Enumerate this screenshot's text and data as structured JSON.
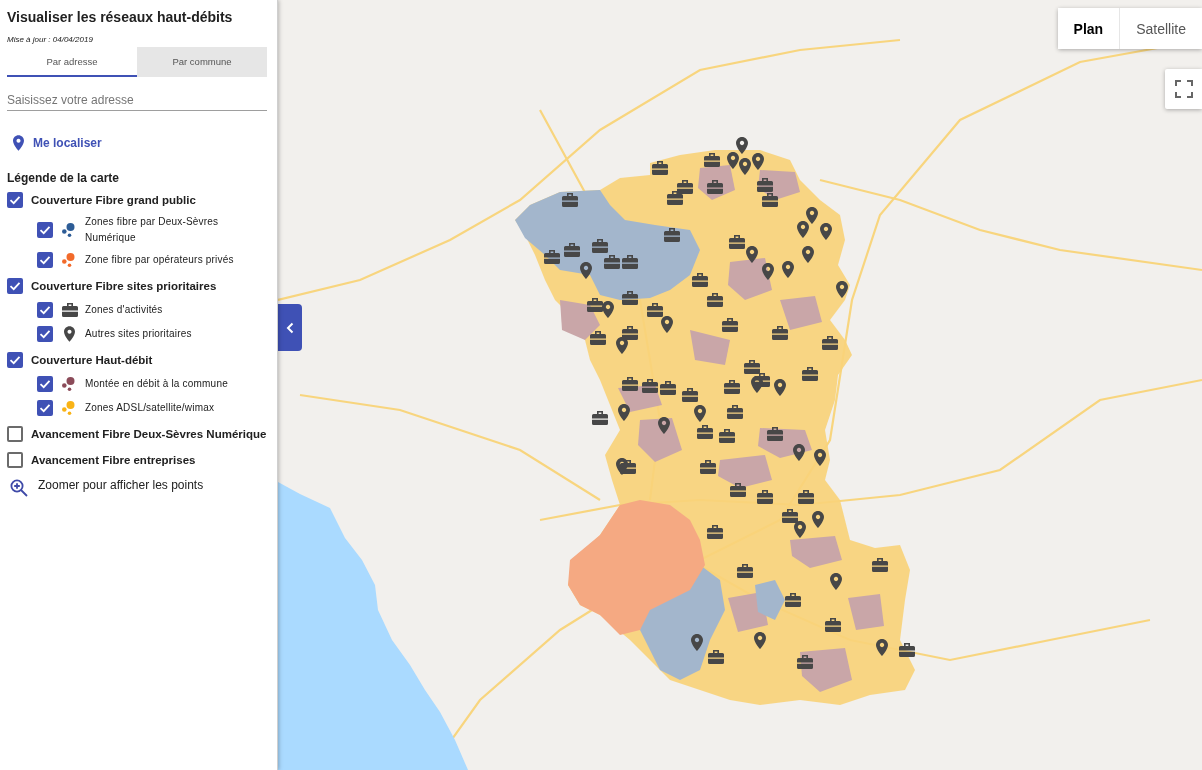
{
  "sidebar": {
    "title": "Visualiser les réseaux haut-débits",
    "updated": "Mise à jour : 04/04/2019",
    "tabs": [
      {
        "label": "Par adresse",
        "selected": true
      },
      {
        "label": "Par commune",
        "selected": false
      }
    ],
    "search": {
      "placeholder": "Saisissez votre adresse"
    },
    "locate_link": "Me localiser",
    "legend": {
      "title": "Légende de la carte",
      "groups": [
        {
          "label": "Couverture Fibre grand public",
          "checked": true,
          "children": [
            {
              "label": "Zones fibre par Deux-Sèvres Numérique",
              "checked": true,
              "kind": "dots",
              "color": "#2d5c96"
            },
            {
              "label": "Zone fibre par opérateurs privés",
              "checked": true,
              "kind": "dots",
              "color": "#f26a2a"
            }
          ]
        },
        {
          "label": "Couverture Fibre sites prioritaires",
          "checked": true,
          "children": [
            {
              "label": "Zones d'activités",
              "checked": true,
              "kind": "briefcase"
            },
            {
              "label": "Autres sites prioritaires",
              "checked": true,
              "kind": "pin"
            }
          ]
        },
        {
          "label": "Couverture Haut-débit",
          "checked": true,
          "children": [
            {
              "label": "Montée en débit à la commune",
              "checked": true,
              "kind": "dots",
              "color": "#8b4b59"
            },
            {
              "label": "Zones ADSL/satellite/wimax",
              "checked": true,
              "kind": "dots",
              "color": "#f9b316"
            }
          ]
        },
        {
          "label": "Avancement Fibre Deux-Sèvres Numérique",
          "checked": false
        },
        {
          "label": "Avancement Fibre entreprises",
          "checked": false
        }
      ]
    },
    "zoom_hint": "Zoomer pour afficher les points"
  },
  "map": {
    "map_type_options": [
      {
        "label": "Plan",
        "selected": true
      },
      {
        "label": "Satellite",
        "selected": false
      }
    ]
  }
}
